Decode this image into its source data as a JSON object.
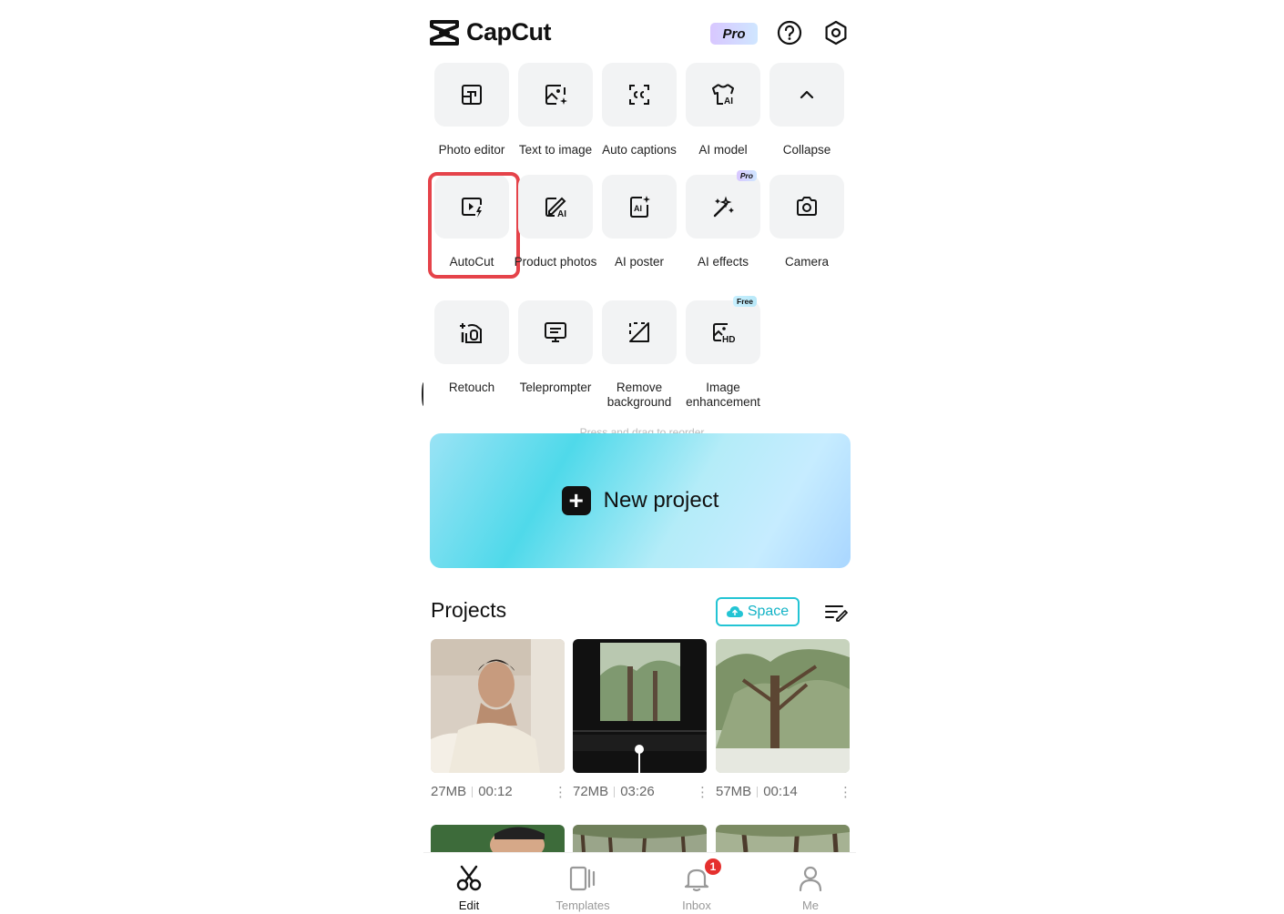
{
  "header": {
    "app_name": "CapCut",
    "pro_badge": "Pro"
  },
  "tools": [
    {
      "label": "Photo editor",
      "icon": "photo-editor-icon"
    },
    {
      "label": "Text to image",
      "icon": "text-to-image-icon"
    },
    {
      "label": "Auto captions",
      "icon": "auto-captions-icon"
    },
    {
      "label": "AI model",
      "icon": "ai-model-icon"
    },
    {
      "label": "Collapse",
      "icon": "chevron-up-icon"
    },
    {
      "label": "AutoCut",
      "icon": "autocut-icon"
    },
    {
      "label": "Product photos",
      "icon": "product-photos-icon"
    },
    {
      "label": "AI poster",
      "icon": "ai-poster-icon"
    },
    {
      "label": "AI effects",
      "icon": "ai-effects-icon",
      "badge": "Pro"
    },
    {
      "label": "Camera",
      "icon": "camera-icon"
    },
    {
      "label": "Retouch",
      "icon": "retouch-icon"
    },
    {
      "label": "Teleprompter",
      "icon": "teleprompter-icon"
    },
    {
      "label": "Remove background",
      "icon": "remove-background-icon"
    },
    {
      "label": "Image enhancement",
      "icon": "image-enhancement-icon",
      "badge": "Free"
    }
  ],
  "reorder_hint": "Press and drag to reorder",
  "new_project": {
    "label": "New project"
  },
  "projects": {
    "title": "Projects",
    "space_label": "Space",
    "items": [
      {
        "size": "27MB",
        "duration": "00:12"
      },
      {
        "size": "72MB",
        "duration": "03:26"
      },
      {
        "size": "57MB",
        "duration": "00:14"
      }
    ]
  },
  "nav": {
    "edit": "Edit",
    "templates": "Templates",
    "inbox": "Inbox",
    "inbox_count": "1",
    "me": "Me"
  },
  "colors": {
    "accent": "#23c4d4",
    "highlight": "#e5434a",
    "badge_red": "#e5302e"
  }
}
